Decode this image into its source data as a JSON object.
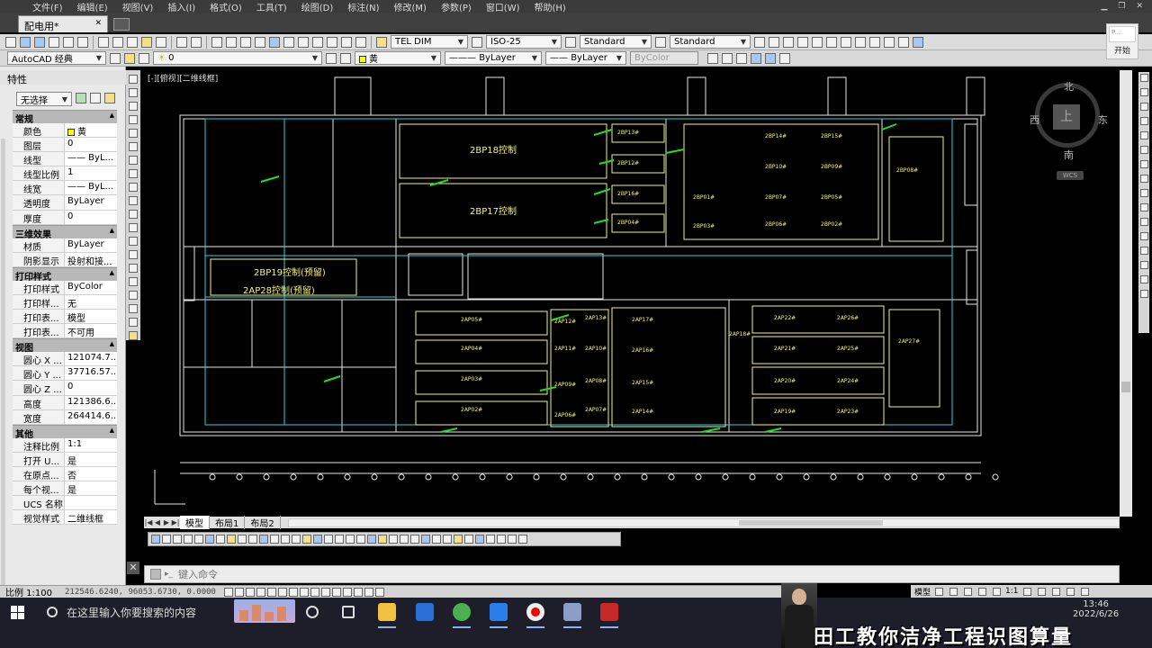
{
  "menu": [
    "文件(F)",
    "编辑(E)",
    "视图(V)",
    "插入(I)",
    "格式(O)",
    "工具(T)",
    "绘图(D)",
    "标注(N)",
    "修改(M)",
    "参数(P)",
    "窗口(W)",
    "帮助(H)"
  ],
  "document_tab": "配电用*",
  "toolbar": {
    "text_style": "TEL DIM",
    "dim_style": "ISO-25",
    "table_style": "Standard",
    "multileader_style": "Standard"
  },
  "workspace": "AutoCAD 经典",
  "layer_current": "0",
  "layer_color_name": "黄",
  "linetype": "ByLayer",
  "lineweight": "ByLayer",
  "plotstyle": "ByColor",
  "start_panel": {
    "thumb": "P...",
    "label": "开始"
  },
  "properties": {
    "title": "特性",
    "selection": "无选择",
    "sections": [
      {
        "name": "常规",
        "rows": [
          {
            "k": "颜色",
            "v": "黄",
            "swatch": true
          },
          {
            "k": "图层",
            "v": "0"
          },
          {
            "k": "线型",
            "v": "—— ByL..."
          },
          {
            "k": "线型比例",
            "v": "1"
          },
          {
            "k": "线宽",
            "v": "—— ByL..."
          },
          {
            "k": "透明度",
            "v": "ByLayer"
          },
          {
            "k": "厚度",
            "v": "0"
          }
        ]
      },
      {
        "name": "三维效果",
        "rows": [
          {
            "k": "材质",
            "v": "ByLayer"
          },
          {
            "k": "阴影显示",
            "v": "投射和接..."
          }
        ]
      },
      {
        "name": "打印样式",
        "rows": [
          {
            "k": "打印样式",
            "v": "ByColor"
          },
          {
            "k": "打印样...",
            "v": "无"
          },
          {
            "k": "打印表...",
            "v": "模型"
          },
          {
            "k": "打印表...",
            "v": "不可用"
          }
        ]
      },
      {
        "name": "视图",
        "rows": [
          {
            "k": "圆心 X ...",
            "v": "121074.7..."
          },
          {
            "k": "圆心 Y ...",
            "v": "37716.57..."
          },
          {
            "k": "圆心 Z ...",
            "v": "0"
          },
          {
            "k": "高度",
            "v": "121386.6..."
          },
          {
            "k": "宽度",
            "v": "264414.6..."
          }
        ]
      },
      {
        "name": "其他",
        "rows": [
          {
            "k": "注释比例",
            "v": "1:1"
          },
          {
            "k": "打开 U...",
            "v": "是"
          },
          {
            "k": "在原点...",
            "v": "否"
          },
          {
            "k": "每个视...",
            "v": "是"
          },
          {
            "k": "UCS 名称",
            "v": ""
          },
          {
            "k": "视觉样式",
            "v": "二维线框"
          }
        ]
      }
    ]
  },
  "viewport_label": "[-][俯视][二维线框]",
  "viewcube": {
    "n": "北",
    "s": "南",
    "e": "东",
    "w": "西",
    "face": "上",
    "wcs": "WCS"
  },
  "drawing_labels": {
    "top_panels": [
      "2BP18控制",
      "2BP17控制"
    ],
    "mid_panels": [
      "2BP19控制(预留)",
      "2AP28控制(预留)"
    ],
    "top_right": [
      "2BP13#",
      "2BP12#",
      "2BP16#",
      "2BP04#",
      "2BP14#",
      "2BP15#",
      "2BP10#",
      "2BP09#",
      "2BP07#",
      "2BP06#",
      "2BP05#",
      "2BP03#",
      "2BP02#",
      "2BP01#",
      "2BP08#"
    ],
    "lower": [
      "2AP05#",
      "2AP04#",
      "2AP03#",
      "2AP02#",
      "2AP12#",
      "2AP13#",
      "2AP11#",
      "2AP10#",
      "2AP09#",
      "2AP08#",
      "2AP07#",
      "2AP06#",
      "2AP17#",
      "2AP16#",
      "2AP15#",
      "2AP14#",
      "2AP22#",
      "2AP26#",
      "2AP21#",
      "2AP25#",
      "2AP20#",
      "2AP24#",
      "2AP19#",
      "2AP23#",
      "2AP27#",
      "2AP18#"
    ]
  },
  "layout_tabs": [
    "模型",
    "布局1",
    "布局2"
  ],
  "command": {
    "placeholder": "键入命令"
  },
  "status": {
    "scale": "比例 1:100",
    "coords": "212546.6240, 96053.6730, 0.0000",
    "model": "模型",
    "anno": "1:1"
  },
  "taskbar": {
    "search_placeholder": "在这里输入你要搜索的内容",
    "time": "13:46",
    "date": "2022/6/26"
  },
  "banner": "田工教你洁净工程识图算量",
  "colors": {
    "cad_yellow": "#f4f47a",
    "cad_cyan": "#27d3df",
    "cad_green": "#22dd22",
    "cad_white": "#e8e8e8"
  }
}
